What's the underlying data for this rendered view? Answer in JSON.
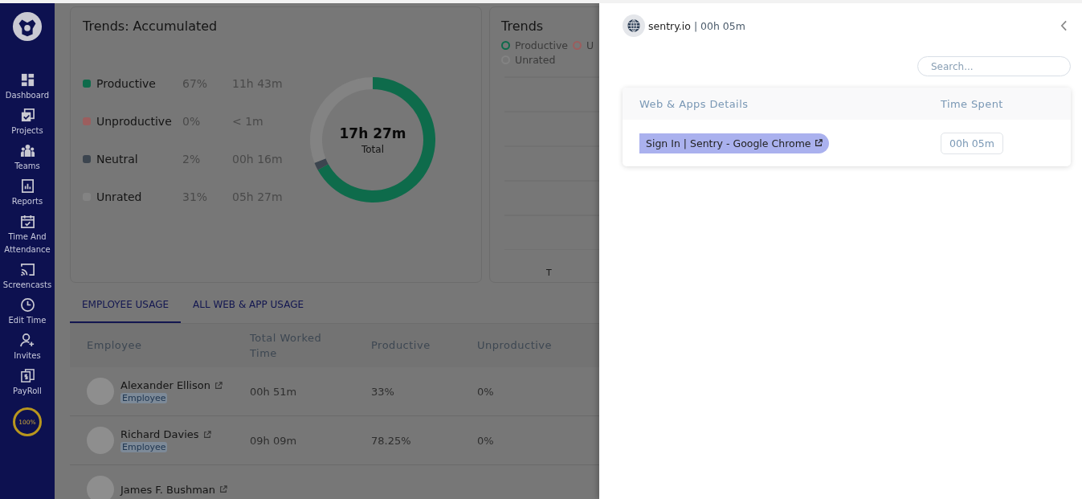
{
  "sidebar": {
    "items": [
      {
        "label": "Dashboard"
      },
      {
        "label": "Projects"
      },
      {
        "label": "Teams"
      },
      {
        "label": "Reports"
      },
      {
        "label": "Time And Attendance"
      },
      {
        "label": "Screencasts"
      },
      {
        "label": "Edit Time"
      },
      {
        "label": "Invites"
      },
      {
        "label": "PayRoll"
      }
    ],
    "progress_badge": "100%"
  },
  "accumulated_card": {
    "title": "Trends: Accumulated",
    "legend": [
      {
        "percent": "67%",
        "time": "11h 43m",
        "color": "#0e6b4b"
      },
      {
        "percent": "0%",
        "time": "< 1m",
        "color": "#9c5e5e"
      },
      {
        "percent": "2%",
        "time": "00h 16m",
        "color": "#3c454f"
      },
      {
        "percent": "31%",
        "time": "05h 27m",
        "color": "#838383"
      }
    ],
    "total": "17h 27m",
    "total_label": "Total",
    "chart_data": {
      "type": "donut",
      "categories": [
        "Productive",
        "Unproductive",
        "Neutral",
        "Unrated"
      ],
      "values": [
        67,
        0,
        2,
        31
      ]
    }
  },
  "trends_card": {
    "title": "Trends",
    "legend": [
      {
        "label": "Productive",
        "color": "#0e6b4b"
      },
      {
        "label": "U",
        "color": "#9c5e5e"
      },
      {
        "label": "Unrated",
        "color": "#838383"
      }
    ],
    "x_label": "T"
  },
  "tabs": [
    {
      "label": "EMPLOYEE USAGE",
      "selected": true
    },
    {
      "label": "ALL WEB & APP USAGE",
      "selected": false
    }
  ],
  "table": {
    "columns": [
      "Employee",
      "Total Worked Time",
      "Productive",
      "Unproductive"
    ],
    "rows": [
      {
        "name": "Alexander Ellison",
        "role": "Employee",
        "worked": "00h 51m",
        "productive": "33%",
        "unproductive": "0%"
      },
      {
        "name": "Richard Davies",
        "role": "Employee",
        "worked": "09h 09m",
        "productive": "78.25%",
        "unproductive": "0%"
      },
      {
        "name": "James F. Bushman"
      }
    ]
  },
  "drawer": {
    "site": "sentry.io",
    "duration": "| 00h 05m",
    "search": {
      "placeholder": "Search..."
    },
    "columns": [
      "Web & Apps Details",
      "Time Spent"
    ],
    "rows": [
      {
        "title": "Sign In | Sentry - Google Chrome",
        "time": "00h 05m"
      }
    ]
  }
}
